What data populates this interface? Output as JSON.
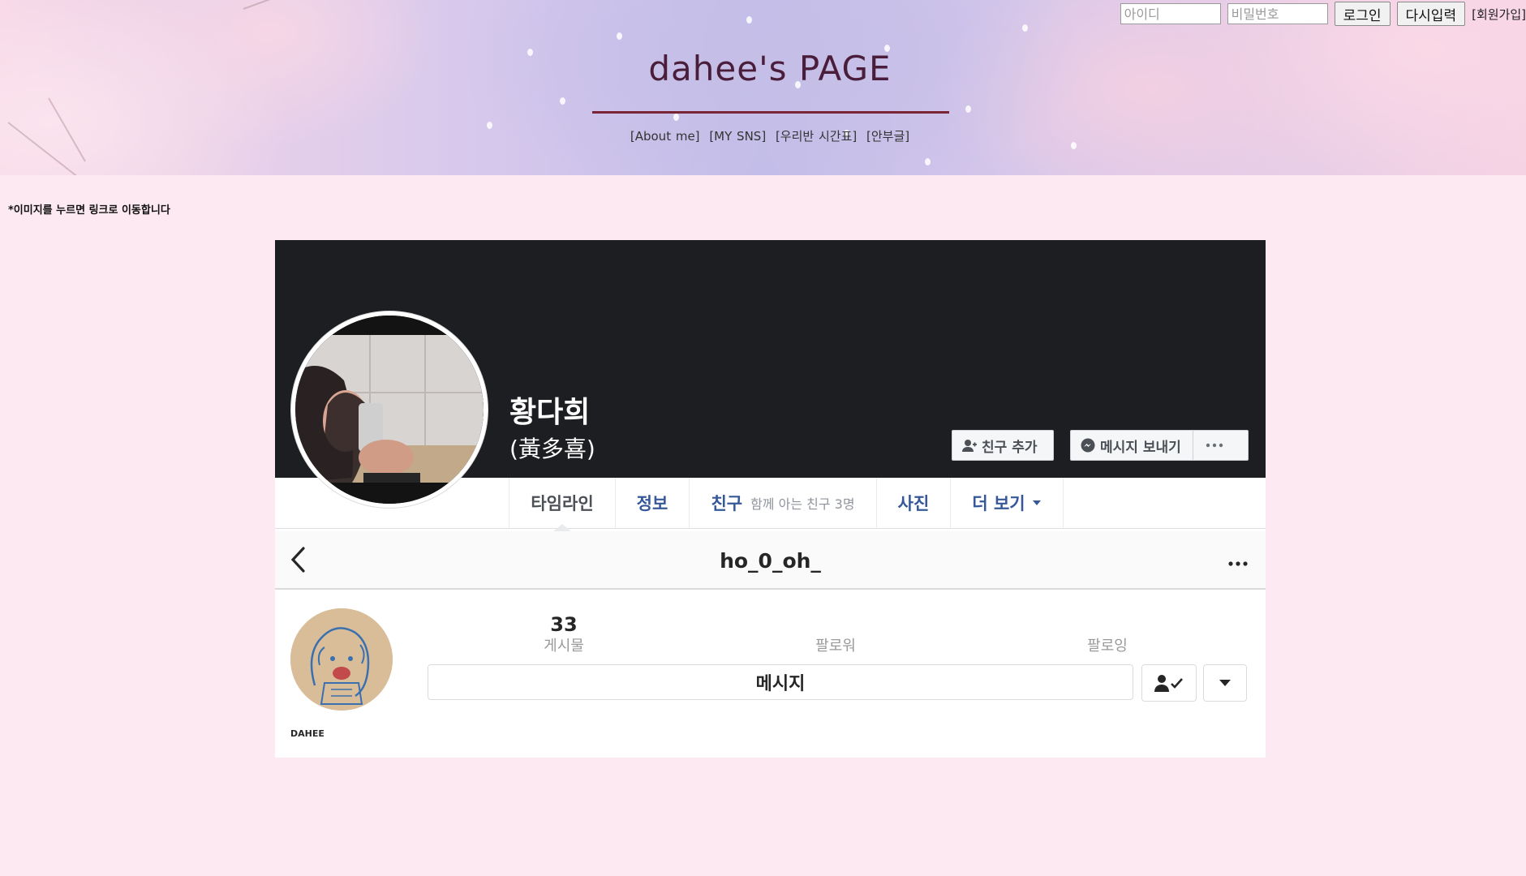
{
  "header": {
    "login": {
      "id_placeholder": "아이디",
      "pw_placeholder": "비밀번호",
      "login_label": "로그인",
      "reset_label": "다시입력",
      "signup_label": "[회원가입]"
    },
    "title": "dahee's PAGE",
    "nav": [
      "[About me]",
      "[MY SNS]",
      "[우리반 시간표]",
      "[안부글]"
    ]
  },
  "hint": "*이미지를 누르면 링크로 이동합니다",
  "facebook": {
    "name": "황다희",
    "name_hanja": "(黃多喜)",
    "add_friend_label": "친구 추가",
    "message_label": "메시지 보내기",
    "tabs": [
      {
        "label": "타임라인"
      },
      {
        "label": "정보"
      },
      {
        "label": "친구",
        "sub": "함께 아는 친구 3명"
      },
      {
        "label": "사진"
      },
      {
        "label": "더 보기"
      }
    ]
  },
  "instagram": {
    "username": "ho_0_oh_",
    "stats": [
      {
        "value": "33",
        "label": "게시물"
      },
      {
        "value": "",
        "label": "팔로워"
      },
      {
        "value": "",
        "label": "팔로잉"
      }
    ],
    "message_label": "메시지",
    "profile_label": "DAHEE"
  },
  "colors": {
    "page_bg": "#fde9f1",
    "title": "#4a1e3a",
    "title_line": "#7b2436",
    "cover": "#1d1e22",
    "fb_link": "#365899"
  }
}
